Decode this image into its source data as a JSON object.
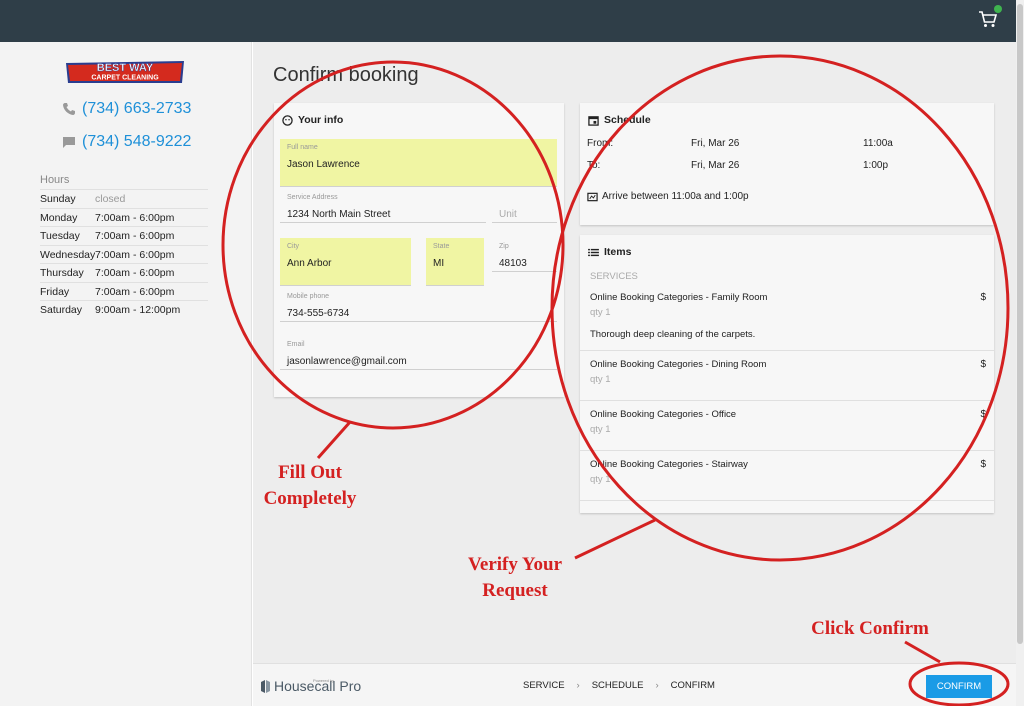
{
  "header": {
    "cart_icon": "cart-icon"
  },
  "sidebar": {
    "logo": {
      "line1": "BEST WAY",
      "line2": "CARPET CLEANING"
    },
    "phone": "(734) 663-2733",
    "text": "(734) 548-9222",
    "hours_label": "Hours",
    "hours": [
      {
        "day": "Sunday",
        "time": "closed"
      },
      {
        "day": "Monday",
        "time": "7:00am - 6:00pm"
      },
      {
        "day": "Tuesday",
        "time": "7:00am - 6:00pm"
      },
      {
        "day": "Wednesday",
        "time": "7:00am - 6:00pm"
      },
      {
        "day": "Thursday",
        "time": "7:00am - 6:00pm"
      },
      {
        "day": "Friday",
        "time": "7:00am - 6:00pm"
      },
      {
        "day": "Saturday",
        "time": "9:00am - 12:00pm"
      }
    ]
  },
  "main": {
    "title": "Confirm booking",
    "your_info": {
      "heading": "Your info",
      "full_name": {
        "label": "Full name",
        "value": "Jason Lawrence"
      },
      "address": {
        "label": "Service Address",
        "value": "1234 North Main Street"
      },
      "unit": {
        "placeholder": "Unit"
      },
      "city": {
        "label": "City",
        "value": "Ann Arbor"
      },
      "state": {
        "label": "State",
        "value": "MI"
      },
      "zip": {
        "label": "Zip",
        "value": "48103"
      },
      "mobile": {
        "label": "Mobile phone",
        "value": "734-555-6734"
      },
      "email": {
        "label": "Email",
        "value": "jasonlawrence@gmail.com"
      }
    },
    "schedule": {
      "heading": "Schedule",
      "from_label": "From:",
      "from_date": "Fri, Mar 26",
      "from_time": "11:00a",
      "to_label": "To:",
      "to_date": "Fri, Mar 26",
      "to_time": "1:00p",
      "arrive": "Arrive between 11:00a and 1:00p"
    },
    "items": {
      "heading": "Items",
      "subheading": "SERVICES",
      "list": [
        {
          "name": "Online Booking Categories - Family Room",
          "qty": "qty 1",
          "price": "$",
          "desc": "Thorough deep cleaning of the carpets."
        },
        {
          "name": "Online Booking Categories - Dining Room",
          "qty": "qty 1",
          "price": "$"
        },
        {
          "name": "Online Booking Categories - Office",
          "qty": "qty 1",
          "price": "$"
        },
        {
          "name": "Online Booking Categories - Stairway",
          "qty": "qty 1",
          "price": "$"
        }
      ]
    }
  },
  "footer": {
    "powered": "Powered by",
    "brand": "Housecall Pro",
    "steps": [
      "SERVICE",
      "SCHEDULE",
      "CONFIRM"
    ],
    "confirm_label": "CONFIRM"
  },
  "annotations": {
    "fill_out": "Fill Out Completely",
    "verify": "Verify Your Request",
    "click_confirm": "Click Confirm"
  },
  "colors": {
    "accent": "#1a9be6",
    "highlight": "#f0f5a3",
    "annotation": "#d42121",
    "topbar": "#2f3e48"
  }
}
